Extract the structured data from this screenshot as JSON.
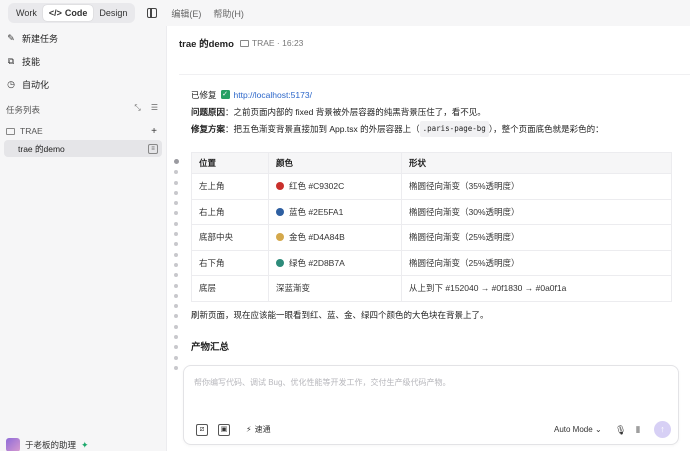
{
  "topbar": {
    "tabs": [
      {
        "label": "Work",
        "active": false
      },
      {
        "label": "Code",
        "active": true
      },
      {
        "label": "Design",
        "active": false
      }
    ],
    "menus": [
      "编辑(E)",
      "帮助(H)"
    ]
  },
  "sidebar": {
    "items": [
      {
        "label": "新建任务",
        "icon": "new-task-icon"
      },
      {
        "label": "技能",
        "icon": "skills-icon"
      },
      {
        "label": "自动化",
        "icon": "clock-icon"
      }
    ],
    "section_title": "任务列表",
    "folder": "TRAE",
    "task": "trae 的demo",
    "user": "于老板的助理"
  },
  "header": {
    "title": "trae 的demo",
    "meta": "TRAE · 16:23"
  },
  "message": {
    "fixed_label": "已修复",
    "url": "http://localhost:5173/",
    "cause_label": "问题原因",
    "cause_text": "：之前页面内部的 fixed 背景被外层容器的纯黑背景压住了，看不见。",
    "fix_label": "修复方案",
    "fix_text_1": "：把五色渐变背景直接加到 App.tsx 的外层容器上（",
    "fix_code": ".paris-page-bg",
    "fix_text_2": "），整个页面底色就是彩色的："
  },
  "table": {
    "headers": [
      "位置",
      "颜色",
      "形状"
    ],
    "rows": [
      {
        "position": "左上角",
        "color": "红色 #C9302C",
        "dot": "#C9302C",
        "shape": "椭圆径向渐变（35%透明度）"
      },
      {
        "position": "右上角",
        "color": "蓝色 #2E5FA1",
        "dot": "#2E5FA1",
        "shape": "椭圆径向渐变（30%透明度）"
      },
      {
        "position": "底部中央",
        "color": "金色 #D4A84B",
        "dot": "#D4A84B",
        "shape": "椭圆径向渐变（25%透明度）"
      },
      {
        "position": "右下角",
        "color": "绿色 #2D8B7A",
        "dot": "#2D8B7A",
        "shape": "椭圆径向渐变（25%透明度）"
      },
      {
        "position": "底层",
        "color": "深蓝渐变",
        "dot": null,
        "shape": "从上到下 #152040 → #0f1830 → #0a0f1a"
      }
    ]
  },
  "after_text": "刷新页面，现在应该能一眼看到红、蓝、金、绿四个颜色的大色块在背景上了。",
  "summary_title": "产物汇总",
  "composer": {
    "placeholder": "帮你编写代码、调试 Bug、优化性能等开发工作，交付生产级代码产物。",
    "quick_label": "速通",
    "mode_label": "Auto Mode"
  },
  "colors": {
    "accent": "#2b66c9",
    "check": "#26a065",
    "send": "#d7d0f5"
  }
}
